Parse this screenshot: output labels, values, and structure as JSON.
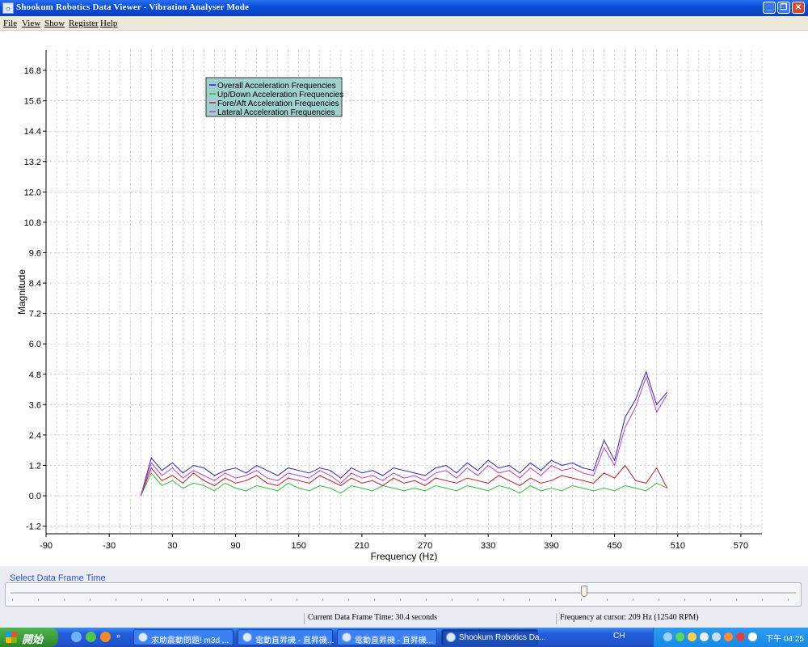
{
  "window": {
    "title": "Shookum Robotics Data Viewer - Vibration Analyser Mode"
  },
  "menu": [
    "File",
    "View",
    "Show",
    "Register",
    "Help"
  ],
  "slider": {
    "label": "Select Data Frame Time",
    "position_fraction": 0.73
  },
  "status": {
    "frame_time": "Current Data Frame Time: 30.4 seconds",
    "cursor_freq": "Frequency at cursor: 209 Hz (12540 RPM)"
  },
  "taskbar": {
    "start_label": "開始",
    "tasks": [
      "求助震動問題! m3d ...",
      "電動直昇機 - 直昇機...",
      "電動直昇機 - 直昇機...",
      "Shookum Robotics Da..."
    ],
    "active_task": 3,
    "lang": "CH",
    "time": "下午 04:25"
  },
  "chart_data": {
    "type": "line",
    "title": "",
    "xlabel": "Frequency (Hz)",
    "ylabel": "Magnitude",
    "xlim": [
      -90,
      590
    ],
    "ylim": [
      -1.5,
      17.6
    ],
    "xticks": [
      -90,
      -30,
      30,
      90,
      150,
      210,
      270,
      330,
      390,
      450,
      510,
      570
    ],
    "yticks": [
      -1.2,
      0.0,
      1.2,
      2.4,
      3.6,
      4.8,
      6.0,
      7.2,
      8.4,
      9.6,
      10.8,
      12.0,
      13.2,
      14.4,
      15.6,
      16.8
    ],
    "grid": true,
    "legend_position": "top-left",
    "series": [
      {
        "name": "Overall Acceleration Frequencies",
        "color": "#2a24c8",
        "x": [
          0,
          10,
          20,
          30,
          40,
          50,
          60,
          70,
          80,
          90,
          100,
          110,
          120,
          130,
          140,
          150,
          160,
          170,
          180,
          190,
          200,
          210,
          220,
          230,
          240,
          250,
          260,
          270,
          280,
          290,
          300,
          310,
          320,
          330,
          340,
          350,
          360,
          370,
          380,
          390,
          400,
          410,
          420,
          430,
          440,
          450,
          460,
          470,
          480,
          490,
          500
        ],
        "y": [
          0.0,
          1.5,
          1.0,
          1.3,
          0.9,
          1.2,
          1.1,
          0.8,
          1.0,
          1.1,
          0.9,
          1.2,
          1.0,
          0.8,
          1.1,
          1.0,
          0.9,
          1.1,
          1.0,
          0.7,
          1.1,
          0.9,
          1.0,
          0.8,
          1.1,
          1.0,
          0.9,
          0.8,
          1.1,
          1.2,
          0.9,
          1.3,
          1.0,
          1.4,
          1.1,
          1.2,
          0.9,
          1.3,
          1.0,
          1.4,
          1.2,
          1.3,
          1.1,
          1.0,
          2.2,
          1.4,
          3.1,
          3.8,
          4.9,
          3.6,
          4.1
        ]
      },
      {
        "name": "Up/Down Acceleration Frequencies",
        "color": "#2fbf3a",
        "x": [
          0,
          10,
          20,
          30,
          40,
          50,
          60,
          70,
          80,
          90,
          100,
          110,
          120,
          130,
          140,
          150,
          160,
          170,
          180,
          190,
          200,
          210,
          220,
          230,
          240,
          250,
          260,
          270,
          280,
          290,
          300,
          310,
          320,
          330,
          340,
          350,
          360,
          370,
          380,
          390,
          400,
          410,
          420,
          430,
          440,
          450,
          460,
          470,
          480,
          490,
          500
        ],
        "y": [
          0.0,
          0.9,
          0.4,
          0.6,
          0.3,
          0.5,
          0.4,
          0.2,
          0.5,
          0.3,
          0.2,
          0.4,
          0.3,
          0.2,
          0.5,
          0.3,
          0.2,
          0.4,
          0.3,
          0.1,
          0.4,
          0.3,
          0.2,
          0.4,
          0.3,
          0.2,
          0.3,
          0.2,
          0.4,
          0.3,
          0.2,
          0.4,
          0.3,
          0.2,
          0.4,
          0.3,
          0.1,
          0.4,
          0.2,
          0.3,
          0.2,
          0.4,
          0.3,
          0.2,
          0.3,
          0.2,
          0.4,
          0.3,
          0.2,
          0.5,
          0.3
        ]
      },
      {
        "name": "Fore/Aft Acceleration Frequencies",
        "color": "#b8202a",
        "x": [
          0,
          10,
          20,
          30,
          40,
          50,
          60,
          70,
          80,
          90,
          100,
          110,
          120,
          130,
          140,
          150,
          160,
          170,
          180,
          190,
          200,
          210,
          220,
          230,
          240,
          250,
          260,
          270,
          280,
          290,
          300,
          310,
          320,
          330,
          340,
          350,
          360,
          370,
          380,
          390,
          400,
          410,
          420,
          430,
          440,
          450,
          460,
          470,
          480,
          490,
          500
        ],
        "y": [
          0.0,
          1.1,
          0.6,
          0.8,
          0.5,
          0.9,
          0.6,
          0.4,
          0.7,
          0.5,
          0.6,
          0.8,
          0.5,
          0.4,
          0.7,
          0.6,
          0.5,
          0.8,
          0.6,
          0.4,
          0.7,
          0.5,
          0.6,
          0.4,
          0.7,
          0.5,
          0.6,
          0.4,
          0.7,
          0.6,
          0.5,
          0.7,
          0.6,
          0.5,
          0.8,
          0.6,
          0.4,
          0.7,
          0.5,
          0.6,
          0.8,
          0.7,
          0.6,
          0.5,
          0.9,
          0.7,
          1.2,
          0.6,
          0.5,
          1.1,
          0.3
        ]
      },
      {
        "name": "Lateral Acceleration Frequencies",
        "color": "#c23ac8",
        "x": [
          0,
          10,
          20,
          30,
          40,
          50,
          60,
          70,
          80,
          90,
          100,
          110,
          120,
          130,
          140,
          150,
          160,
          170,
          180,
          190,
          200,
          210,
          220,
          230,
          240,
          250,
          260,
          270,
          280,
          290,
          300,
          310,
          320,
          330,
          340,
          350,
          360,
          370,
          380,
          390,
          400,
          410,
          420,
          430,
          440,
          450,
          460,
          470,
          480,
          490,
          500
        ],
        "y": [
          0.0,
          1.3,
          0.8,
          1.1,
          0.7,
          1.0,
          0.8,
          0.6,
          0.9,
          0.7,
          0.8,
          1.0,
          0.7,
          0.6,
          0.9,
          0.8,
          0.7,
          1.0,
          0.8,
          0.5,
          0.9,
          0.7,
          0.8,
          0.6,
          0.9,
          0.7,
          0.8,
          0.6,
          0.9,
          1.0,
          0.7,
          1.1,
          0.8,
          1.2,
          0.9,
          1.0,
          0.7,
          1.1,
          0.8,
          1.2,
          1.0,
          1.1,
          0.9,
          0.8,
          1.9,
          1.2,
          2.7,
          3.5,
          4.7,
          3.3,
          4.0
        ]
      }
    ]
  }
}
